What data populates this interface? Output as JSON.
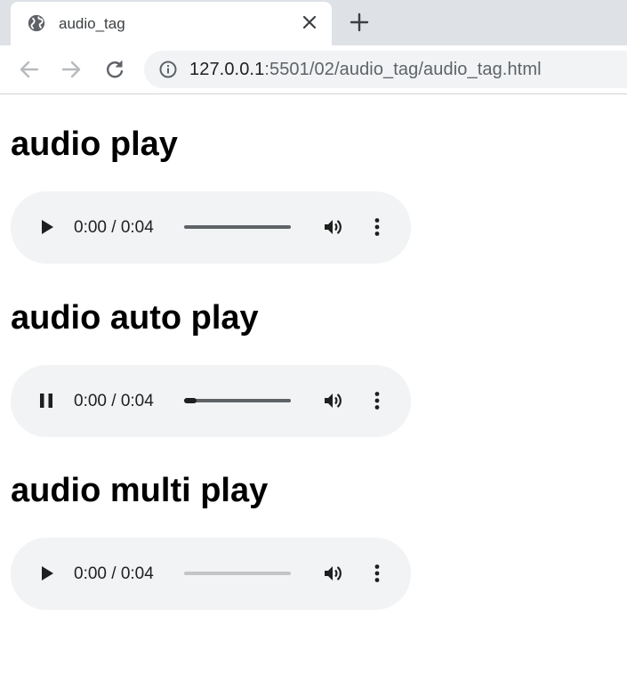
{
  "browser": {
    "tab": {
      "title": "audio_tag",
      "favicon": "globe-icon",
      "close_icon": "close-icon"
    },
    "new_tab_icon": "plus-icon",
    "nav": {
      "back_icon": "arrow-left-icon",
      "forward_icon": "arrow-right-icon",
      "reload_icon": "reload-icon"
    },
    "address": {
      "info_icon": "info-icon",
      "host": "127.0.0.1",
      "rest": ":5501/02/audio_tag/audio_tag.html"
    }
  },
  "sections": [
    {
      "title": "audio play",
      "player": {
        "state": "paused",
        "time": "0:00 / 0:04",
        "progress": 0.0,
        "track_style": "normal",
        "icons": [
          "play-icon",
          "volume-icon",
          "more-vert-icon"
        ]
      }
    },
    {
      "title": "audio auto play",
      "player": {
        "state": "playing",
        "time": "0:00 / 0:04",
        "progress": 0.12,
        "track_style": "normal",
        "icons": [
          "pause-icon",
          "volume-icon",
          "more-vert-icon"
        ]
      }
    },
    {
      "title": "audio multi play",
      "player": {
        "state": "paused",
        "time": "0:00 / 0:04",
        "progress": 0.0,
        "track_style": "dimmed",
        "icons": [
          "play-icon",
          "volume-icon",
          "more-vert-icon"
        ]
      }
    }
  ],
  "colors": {
    "tabstrip": "#dee1e6",
    "omnibox": "#f1f3f4",
    "player_bg": "#f1f3f4"
  }
}
